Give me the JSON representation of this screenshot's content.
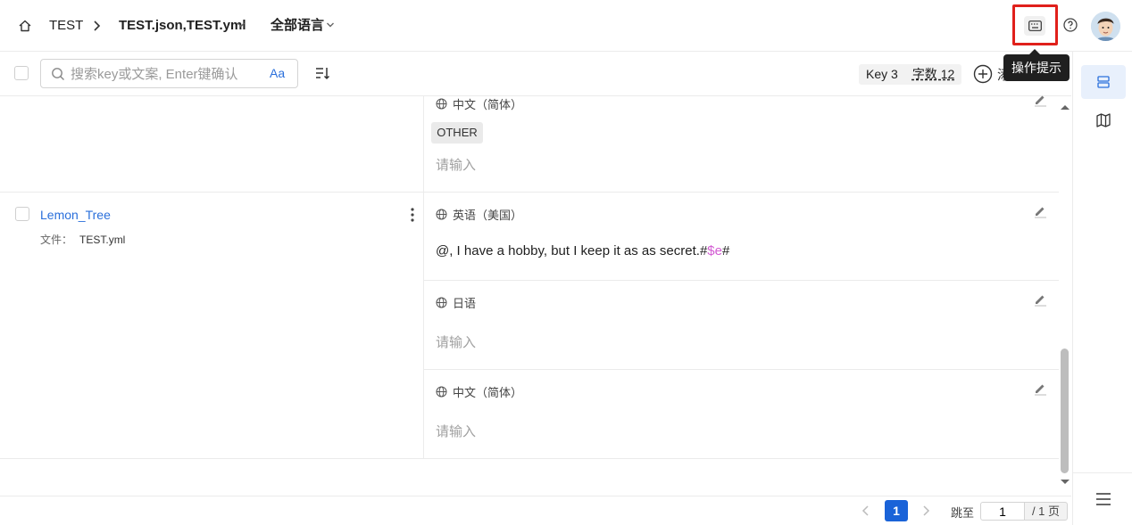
{
  "header": {
    "project": "TEST",
    "files": "TEST.json,TEST.yml",
    "language_filter": "全部语言",
    "tooltip": "操作提示"
  },
  "toolbar": {
    "search_placeholder": "搜索key或文案, Enter键确认",
    "case_toggle": "Aa",
    "key_count_label": "Key 3",
    "char_count_label": "字数 12",
    "add_label_partial": "添"
  },
  "entries": [
    {
      "translations": [
        {
          "language": "中文（简体）",
          "tag": "OTHER",
          "placeholder": "请输入"
        }
      ]
    },
    {
      "key": "Lemon_Tree",
      "file_label": "文件：",
      "file_name": "TEST.yml",
      "translations": [
        {
          "language": "英语（美国）",
          "value_prefix": "@, I have a hobby, but I keep it as as secret.#",
          "value_var": "$e",
          "value_suffix": "#"
        },
        {
          "language": "日语",
          "placeholder": "请输入"
        },
        {
          "language": "中文（简体）",
          "placeholder": "请输入"
        }
      ]
    }
  ],
  "pagination": {
    "current": "1",
    "jump_label": "跳至",
    "jump_value": "1",
    "total_label": "/ 1 页"
  },
  "colors": {
    "accent": "#1a63d8",
    "link": "#2a6fdb",
    "variable": "#d35bd3",
    "highlight_box": "#e0201b"
  }
}
